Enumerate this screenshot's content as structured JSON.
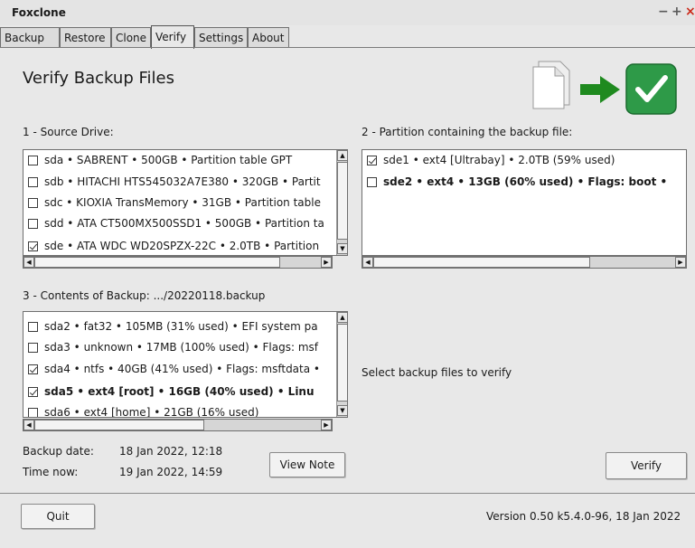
{
  "window": {
    "title": "Foxclone",
    "minimize": "−",
    "maximize": "+",
    "close": "×"
  },
  "tabs": [
    {
      "label": "Backup"
    },
    {
      "label": "Restore"
    },
    {
      "label": "Clone"
    },
    {
      "label": "Verify"
    },
    {
      "label": "Settings"
    },
    {
      "label": "About"
    }
  ],
  "active_tab": "Verify",
  "page": {
    "heading": "Verify Backup Files",
    "icon_files": "document-icon",
    "icon_arrow": "green-arrow-icon",
    "icon_check": "green-checkmark-icon"
  },
  "source": {
    "label": "1 - Source Drive:",
    "items": [
      {
        "text": "sda • SABRENT • 500GB • Partition table GPT",
        "checked": false,
        "bold": false
      },
      {
        "text": "sdb • HITACHI HTS545032A7E380 • 320GB • Partit",
        "checked": false,
        "bold": false
      },
      {
        "text": "sdc • KIOXIA TransMemory • 31GB • Partition table",
        "checked": false,
        "bold": false
      },
      {
        "text": "sdd • ATA CT500MX500SSD1 • 500GB • Partition ta",
        "checked": false,
        "bold": false
      },
      {
        "text": "sde • ATA WDC WD20SPZX-22C • 2.0TB • Partition",
        "checked": true,
        "bold": false
      }
    ]
  },
  "partition": {
    "label": "2 - Partition containing the backup file:",
    "items": [
      {
        "text": "sde1 • ext4 [Ultrabay] • 2.0TB (59% used)",
        "checked": true,
        "bold": false
      },
      {
        "text": "sde2 • ext4 • 13GB (60% used) • Flags: boot •",
        "checked": false,
        "bold": true
      }
    ]
  },
  "contents": {
    "label": "3 - Contents of Backup: .../20220118.backup",
    "items": [
      {
        "text": "sda2 • fat32 • 105MB (31% used) • EFI system pa",
        "checked": false,
        "bold": false
      },
      {
        "text": "sda3 • unknown • 17MB (100% used) • Flags: msf",
        "checked": false,
        "bold": false
      },
      {
        "text": "sda4 • ntfs • 40GB (41% used) • Flags: msftdata •",
        "checked": true,
        "bold": false
      },
      {
        "text": "sda5 • ext4 [root] • 16GB (40% used) • Linu",
        "checked": true,
        "bold": true
      },
      {
        "text": "sda6 • ext4 [home] • 21GB (16% used)",
        "checked": false,
        "bold": false
      }
    ]
  },
  "status_message": "Select backup files to verify",
  "backup_info": {
    "backup_date_label": "Backup date:",
    "backup_date_value": "18 Jan 2022, 12:18",
    "time_now_label": "Time now:",
    "time_now_value": "19 Jan 2022, 14:59"
  },
  "buttons": {
    "view_note": "View Note",
    "verify": "Verify",
    "quit": "Quit"
  },
  "version": "Version 0.50 k5.4.0-96, 18 Jan 2022",
  "colors": {
    "check_green": "#2e9a48",
    "arrow_green": "#1f8a1f",
    "close_red": "#cc2a1a"
  }
}
